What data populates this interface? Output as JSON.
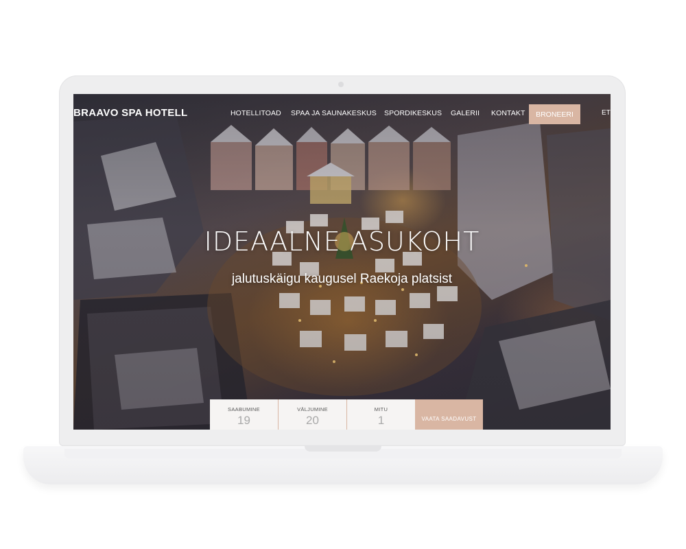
{
  "site": {
    "logo": "BRAAVO SPA HOTELL",
    "nav": [
      {
        "label": "HOTELLITOAD"
      },
      {
        "label": "SPAA JA SAUNAKESKUS"
      },
      {
        "label": "SPORDIKESKUS"
      },
      {
        "label": "GALERII"
      },
      {
        "label": "KONTAKT"
      }
    ],
    "book_button": "BRONEERI",
    "language": "ET"
  },
  "hero": {
    "title": "IDEAALNE ASUKOHT",
    "subtitle": "jalutuskäigu kaugusel Raekoja platsist"
  },
  "booking": {
    "arrival_label": "SAABUMINE",
    "arrival_value": "19",
    "departure_label": "VÄLJUMINE",
    "departure_value": "20",
    "guests_label": "MITU",
    "guests_value": "1",
    "submit_label": "VAATA SAADAVUST"
  },
  "colors": {
    "accent": "#d9b6a3",
    "booking_bg": "#f6f4f3",
    "text_light": "#ffffff"
  }
}
